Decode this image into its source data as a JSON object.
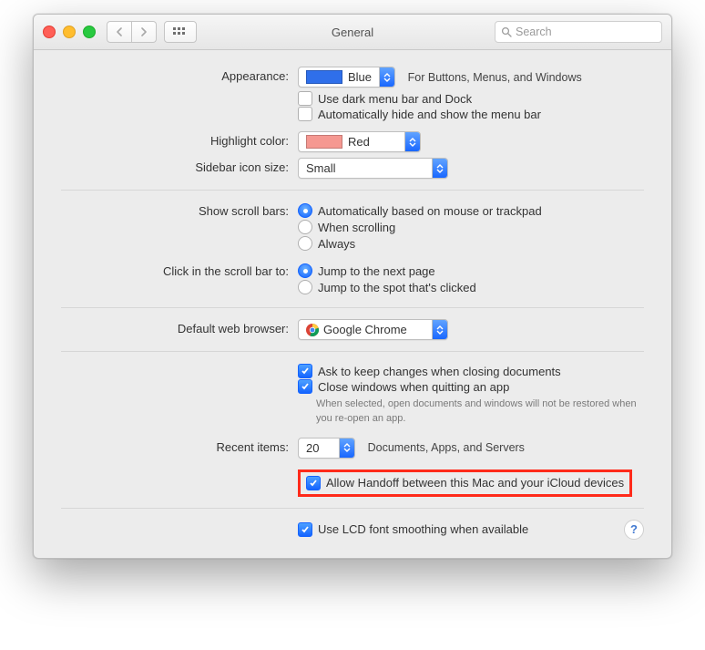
{
  "window": {
    "title": "General"
  },
  "search": {
    "placeholder": "Search"
  },
  "labels": {
    "appearance": "Appearance:",
    "highlight_color": "Highlight color:",
    "sidebar_icon_size": "Sidebar icon size:",
    "show_scroll_bars": "Show scroll bars:",
    "click_in_scroll_bar": "Click in the scroll bar to:",
    "default_web_browser": "Default web browser:",
    "recent_items": "Recent items:"
  },
  "appearance": {
    "value": "Blue",
    "swatch_color": "#2f6fea",
    "note": "For Buttons, Menus, and Windows",
    "dark_menubar": "Use dark menu bar and Dock",
    "auto_hide_menubar": "Automatically hide and show the menu bar"
  },
  "highlight_color": {
    "value": "Red",
    "swatch_color": "#f59891"
  },
  "sidebar_icon_size": {
    "value": "Small"
  },
  "scroll_bars": {
    "opt_auto": "Automatically based on mouse or trackpad",
    "opt_when_scrolling": "When scrolling",
    "opt_always": "Always"
  },
  "click_scroll": {
    "opt_next_page": "Jump to the next page",
    "opt_clicked_spot": "Jump to the spot that's clicked"
  },
  "browser": {
    "value": "Google Chrome"
  },
  "documents": {
    "ask_keep_changes": "Ask to keep changes when closing documents",
    "close_windows_quit": "Close windows when quitting an app",
    "note": "When selected, open documents and windows will not be restored when you re-open an app."
  },
  "recent_items": {
    "value": "20",
    "after": "Documents, Apps, and Servers"
  },
  "handoff": {
    "label": "Allow Handoff between this Mac and your iCloud devices"
  },
  "lcd": {
    "label": "Use LCD font smoothing when available"
  }
}
